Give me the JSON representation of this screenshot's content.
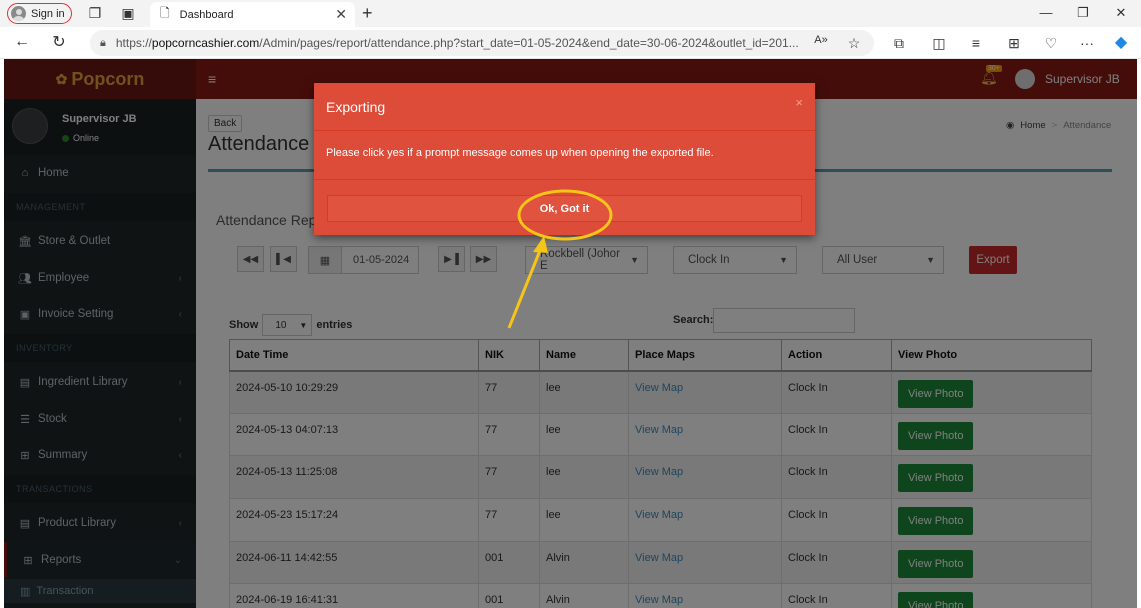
{
  "browser": {
    "sign_in": "Sign in",
    "tab_title": "Dashboard",
    "url_prefix": "https://",
    "url_host": "popcorncashier.com",
    "url_rest": "/Admin/pages/report/attendance.php?start_date=01-05-2024&end_date=30-06-2024&outlet_id=201..."
  },
  "app": {
    "logo": "Popcorn",
    "user_name": "Supervisor JB",
    "user_status": "Online",
    "topnav_user": "Supervisor JB",
    "notification_count": "30+"
  },
  "sidebar": {
    "home": "Home",
    "management_header": "MANAGEMENT",
    "store_outlet": "Store & Outlet",
    "employee": "Employee",
    "invoice_setting": "Invoice Setting",
    "inventory_header": "INVENTORY",
    "ingredient_library": "Ingredient Library",
    "stock": "Stock",
    "summary": "Summary",
    "transactions_header": "TRANSACTIONS",
    "product_library": "Product Library",
    "reports": "Reports",
    "transaction": "Transaction"
  },
  "page": {
    "back": "Back",
    "title": "Attendance",
    "breadcrumb_home": "Home",
    "breadcrumb_sep": ">",
    "breadcrumb_current": "Attendance",
    "section_title": "Attendance Rep",
    "date_value": "01-05-2024",
    "outlet_select": "Rockbell (Johor E",
    "action_select": "Clock In",
    "user_select": "All User",
    "export": "Export",
    "show_label": "Show",
    "entries_value": "10",
    "entries_label": "entries",
    "search_label": "Search:"
  },
  "table": {
    "headers": [
      "Date Time",
      "NIK",
      "Name",
      "Place Maps",
      "Action",
      "View Photo"
    ],
    "rows": [
      {
        "datetime": "2024-05-10 10:29:29",
        "nik": "77",
        "name": "lee",
        "map": "View Map",
        "action": "Clock In",
        "photo": "View Photo"
      },
      {
        "datetime": "2024-05-13 04:07:13",
        "nik": "77",
        "name": "lee",
        "map": "View Map",
        "action": "Clock In",
        "photo": "View Photo"
      },
      {
        "datetime": "2024-05-13 11:25:08",
        "nik": "77",
        "name": "lee",
        "map": "View Map",
        "action": "Clock In",
        "photo": "View Photo"
      },
      {
        "datetime": "2024-05-23 15:17:24",
        "nik": "77",
        "name": "lee",
        "map": "View Map",
        "action": "Clock In",
        "photo": "View Photo"
      },
      {
        "datetime": "2024-06-11 14:42:55",
        "nik": "001",
        "name": "Alvin",
        "map": "View Map",
        "action": "Clock In",
        "photo": "View Photo"
      },
      {
        "datetime": "2024-06-19 16:41:31",
        "nik": "001",
        "name": "Alvin",
        "map": "View Map",
        "action": "Clock In",
        "photo": "View Photo"
      }
    ]
  },
  "modal": {
    "title": "Exporting",
    "close": "×",
    "message": "Please click yes if a prompt message comes up when opening the exported file.",
    "ok_button": "Ok, Got it"
  },
  "colors": {
    "brand": "#8b1a12",
    "modal": "#dd4b39",
    "annotation": "#f5c518",
    "success": "#1d8a3b",
    "link": "#3c8dbc"
  }
}
